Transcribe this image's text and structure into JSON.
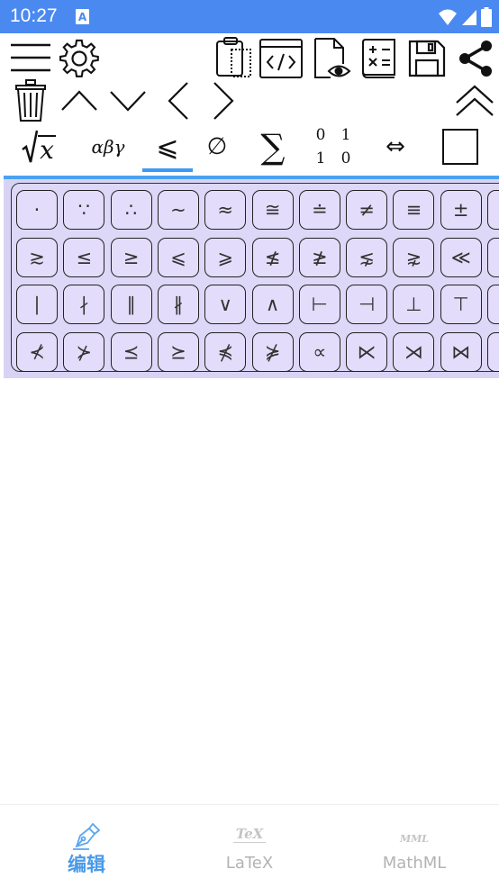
{
  "status": {
    "time": "10:27",
    "notification_icon": "a-icon"
  },
  "toolbar1": {
    "icons": [
      "menu-icon",
      "settings-icon",
      "clipboard-icon",
      "code-icon",
      "preview-icon",
      "calculator-icon",
      "save-icon",
      "share-icon"
    ]
  },
  "toolbar2": {
    "icons": [
      "delete-icon",
      "arrow-up-icon",
      "arrow-down-icon",
      "arrow-left-icon",
      "arrow-right-icon",
      "collapse-icon"
    ]
  },
  "categories": {
    "sqrt_x": "x",
    "greek": "αβγ",
    "relations": "⩽",
    "sets": "∅",
    "sum": "∑",
    "matrix": [
      "0",
      "1",
      "1",
      "0"
    ],
    "arrows": "⇔",
    "selected": "relations"
  },
  "symbols": [
    [
      "·",
      "∵",
      "∴",
      "∼",
      "≈",
      "≅",
      "≐",
      "≠",
      "≡",
      "±"
    ],
    [
      "≳",
      "≤",
      "≥",
      "⩽",
      "⩾",
      "≰",
      "≱",
      "⋦",
      "⋧",
      "≪"
    ],
    [
      "∣",
      "∤",
      "∥",
      "∦",
      "∨",
      "∧",
      "⊢",
      "⊣",
      "⊥",
      "⊤"
    ],
    [
      "⊀",
      "⊁",
      "⪯",
      "⪰",
      "⋠",
      "⋡",
      "∝",
      "⋉",
      "⋊",
      "⋈"
    ]
  ],
  "bottom_nav": [
    {
      "icon": "pen-icon",
      "label": "编辑",
      "active": true
    },
    {
      "icon": "tex-icon",
      "icon_text": "TeX",
      "label": "LaTeX",
      "active": false
    },
    {
      "icon": "mml-icon",
      "icon_text": "MML",
      "label": "MathML",
      "active": false
    }
  ],
  "colors": {
    "statusbar": "#4a89f0",
    "accent": "#3b9af5",
    "panel": "#d8d3f4",
    "key": "#e3ddfb",
    "inactive": "#c4c4c4"
  }
}
